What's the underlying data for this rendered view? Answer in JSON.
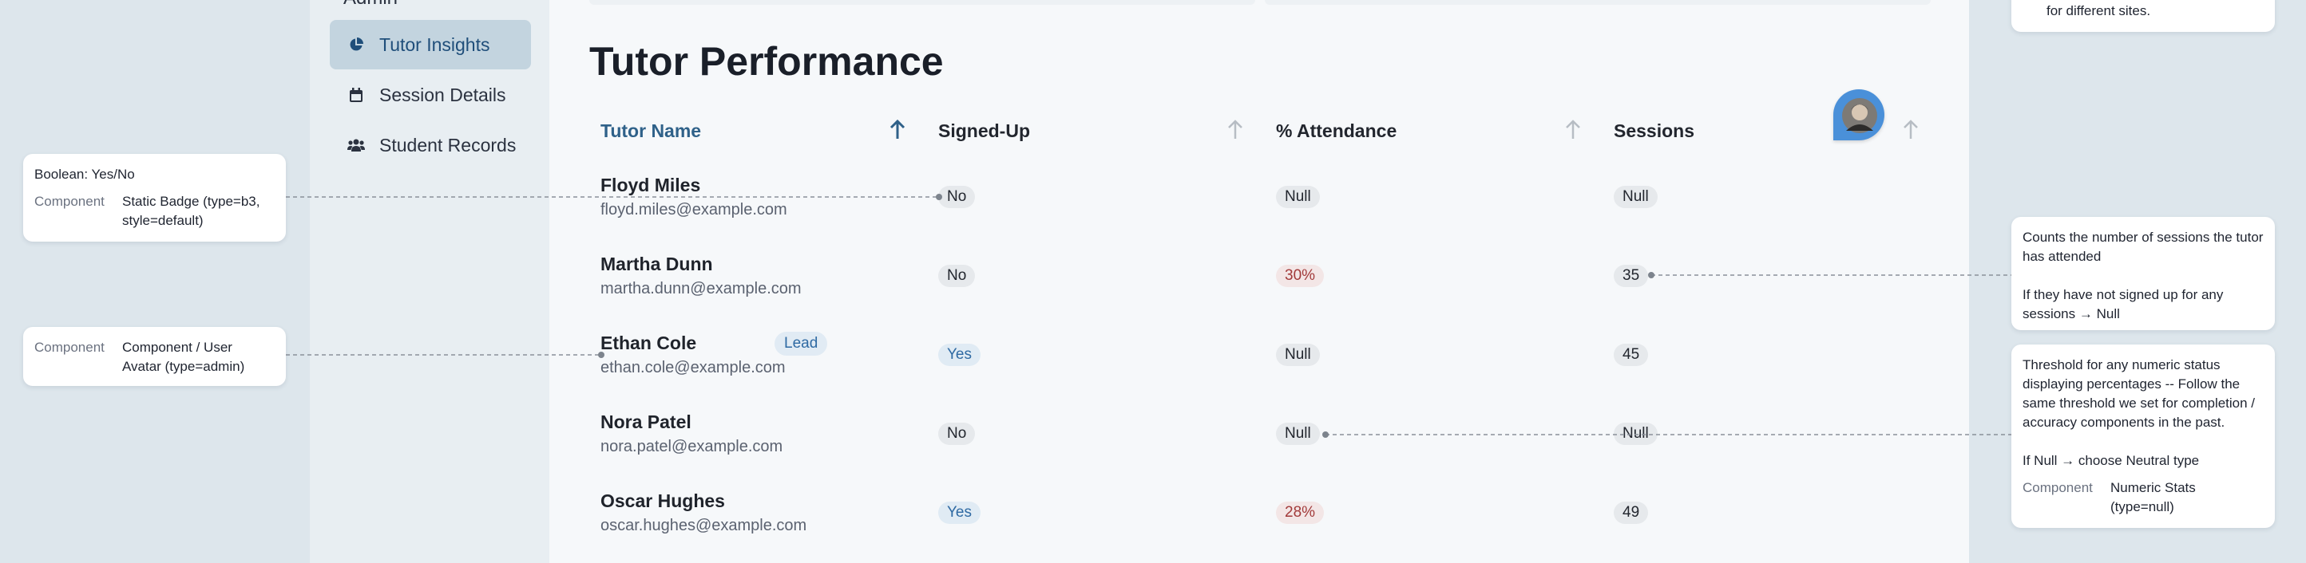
{
  "sidebar": {
    "section_label": "Admin",
    "items": [
      {
        "label": "Tutor Insights",
        "icon": "pie-chart-icon",
        "active": true
      },
      {
        "label": "Session Details",
        "icon": "calendar-icon",
        "active": false
      },
      {
        "label": "Student Records",
        "icon": "users-icon",
        "active": false
      }
    ]
  },
  "page": {
    "title": "Tutor Performance"
  },
  "table": {
    "columns": [
      {
        "label": "Tutor Name",
        "sorted": true
      },
      {
        "label": "Signed-Up",
        "sorted": false
      },
      {
        "label": "% Attendance",
        "sorted": false
      },
      {
        "label": "Sessions",
        "sorted": false
      }
    ],
    "rows": [
      {
        "name": "Floyd Miles",
        "email": "floyd.miles@example.com",
        "signed_up": "No",
        "attendance": "Null",
        "sessions": "Null"
      },
      {
        "name": "Martha Dunn",
        "email": "martha.dunn@example.com",
        "signed_up": "No",
        "attendance": "30%",
        "sessions": "35"
      },
      {
        "name": "Ethan Cole",
        "email": "ethan.cole@example.com",
        "tag": "Lead",
        "signed_up": "Yes",
        "attendance": "Null",
        "sessions": "45"
      },
      {
        "name": "Nora Patel",
        "email": "nora.patel@example.com",
        "signed_up": "No",
        "attendance": "Null",
        "sessions": "Null"
      },
      {
        "name": "Oscar Hughes",
        "email": "oscar.hughes@example.com",
        "signed_up": "Yes",
        "attendance": "28%",
        "sessions": "49"
      }
    ]
  },
  "annotations": {
    "top_right": {
      "text": "for different sites."
    },
    "boolean": {
      "title": "Boolean: Yes/No",
      "key": "Component",
      "value": "Static Badge (type=b3, style=default)"
    },
    "avatar": {
      "key": "Component",
      "value": "Component / User Avatar (type=admin)"
    },
    "sessions": {
      "line1": "Counts the number of sessions the tutor has attended",
      "line2": "If they have not signed up for any sessions → Null"
    },
    "threshold": {
      "line1": "Threshold for any numeric status displaying percentages -- Follow the same threshold we set for completion / accuracy components in the past.",
      "line2": "If Null → choose Neutral type",
      "key": "Component",
      "value": "Numeric Stats (type=null)"
    }
  },
  "colors": {
    "accent": "#2f6189",
    "active_nav_bg": "#c3d4df",
    "negative": "#a23a3a",
    "positive_badge": "#2f6aa3",
    "avatar_bg": "#4a90d9"
  }
}
